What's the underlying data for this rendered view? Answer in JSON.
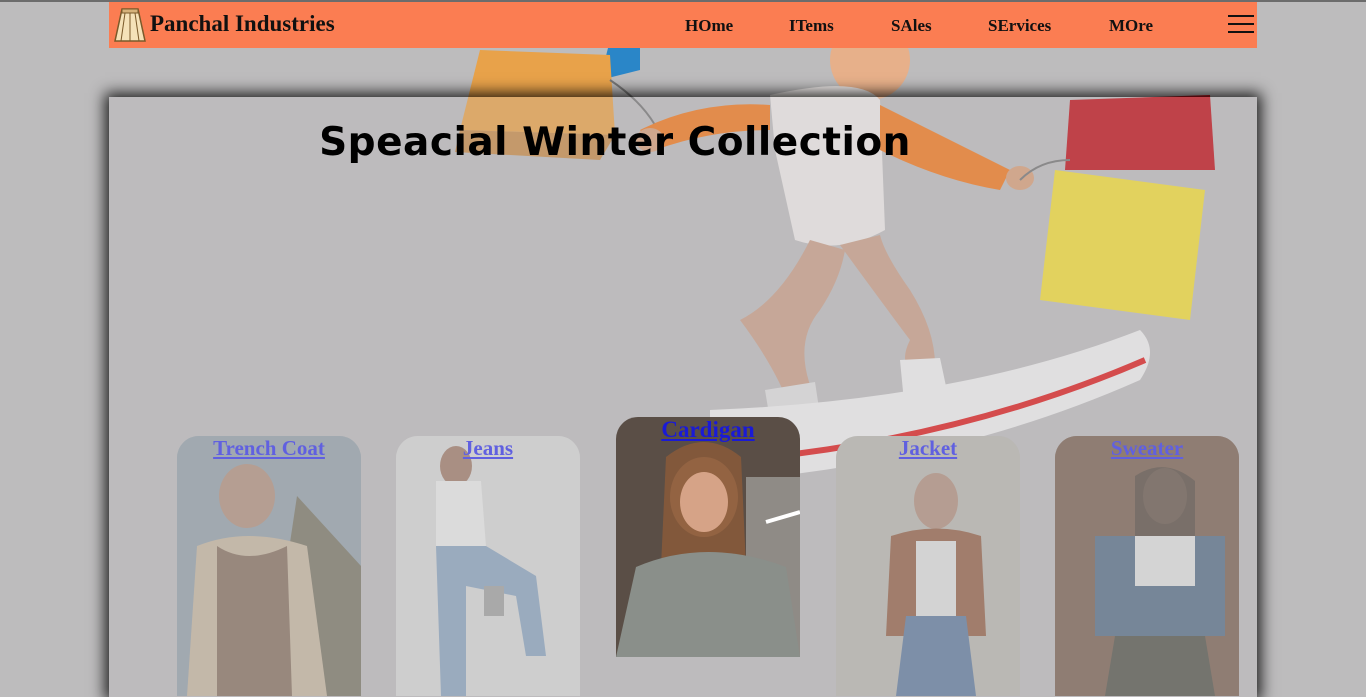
{
  "brand": {
    "name": "Panchal Industries",
    "logo_icon": "skirt-logo-icon"
  },
  "nav": {
    "items": [
      {
        "label": "HOme"
      },
      {
        "label": "ITems"
      },
      {
        "label": "SAles"
      },
      {
        "label": "SErvices"
      },
      {
        "label": "MOre"
      }
    ],
    "menu_icon": "hamburger-menu-icon"
  },
  "hero": {
    "title": "Speacial Winter Collection"
  },
  "cards": [
    {
      "label": "Trench Coat"
    },
    {
      "label": "Jeans"
    },
    {
      "label": "Cardigan"
    },
    {
      "label": "Jacket"
    },
    {
      "label": "Sweater"
    }
  ],
  "colors": {
    "navbar": "#fb7d52",
    "background": "#bdbcbd",
    "link": "#1a1ad6"
  }
}
